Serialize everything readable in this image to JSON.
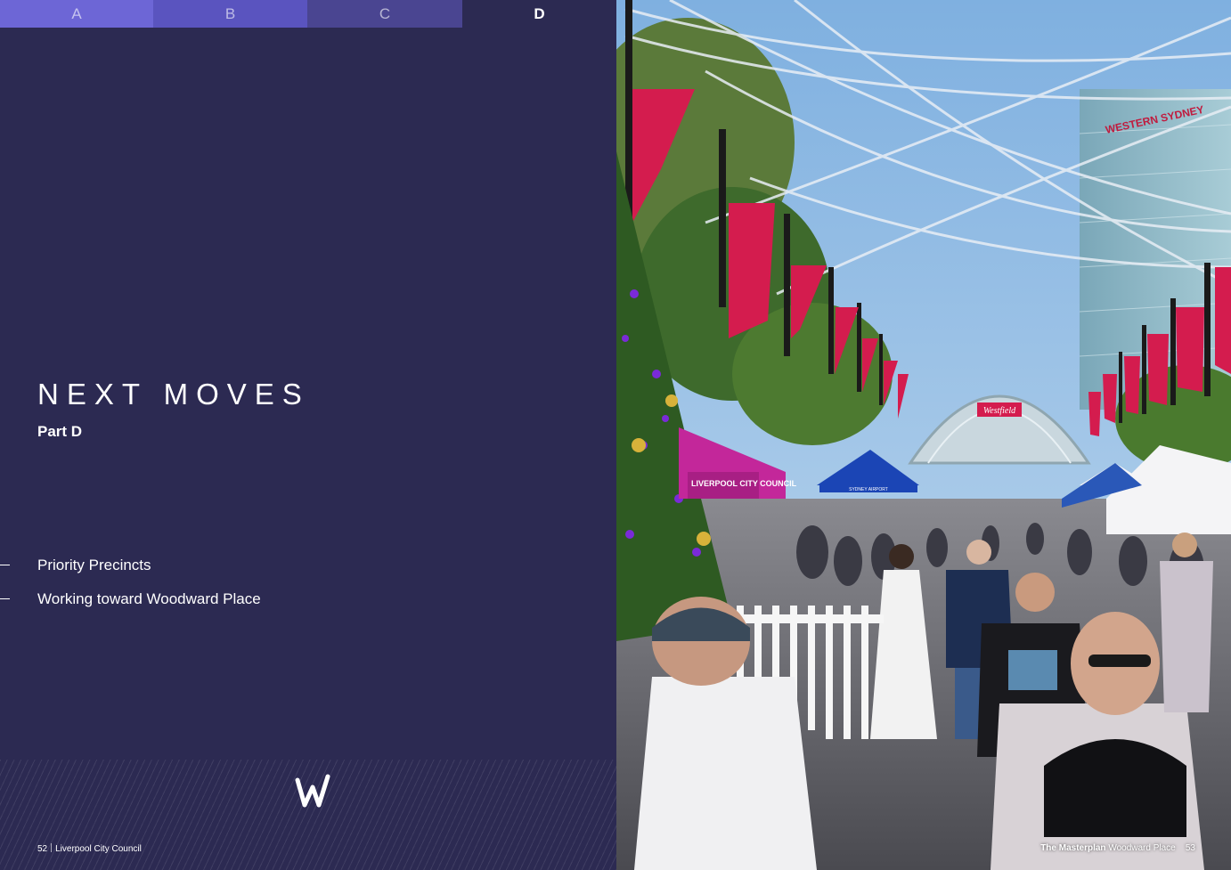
{
  "tabs": [
    {
      "label": "A",
      "active": false
    },
    {
      "label": "B",
      "active": false
    },
    {
      "label": "C",
      "active": false
    },
    {
      "label": "D",
      "active": true
    }
  ],
  "section": {
    "title": "NEXT MOVES",
    "subtitle": "Part D"
  },
  "toc": [
    {
      "label": "Priority Precincts"
    },
    {
      "label": "Working toward Woodward Place"
    }
  ],
  "footer_left": {
    "page_number": "52",
    "publisher": "Liverpool City Council"
  },
  "footer_right": {
    "doc_title": "The Masterplan",
    "doc_subtitle": "Woodward Place",
    "page_number": "53"
  },
  "photo": {
    "signs": [
      "LIVERPOOL CITY COUNCIL",
      "SYDNEY AIRPORT",
      "Westfield",
      "WESTERN SYDNEY"
    ]
  },
  "colors": {
    "page_bg": "#2c2a52",
    "tab_a": "#6d66d6",
    "tab_b": "#5a54bf",
    "tab_c": "#4a4591",
    "banner_red": "#d41c4e",
    "sky": "#9fc4e8"
  }
}
